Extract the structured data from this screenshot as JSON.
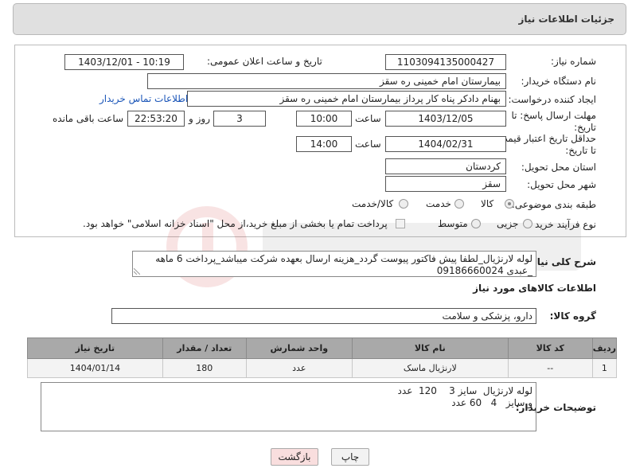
{
  "header": {
    "title": "جزئیات اطلاعات نیاز"
  },
  "form": {
    "need_number_label": "شماره نیاز:",
    "need_number": "1103094135000427",
    "announce_label": "تاریخ و ساعت اعلان عمومی:",
    "announce_value": "1403/12/01 - 10:19",
    "buyer_org_label": "نام دستگاه خریدار:",
    "buyer_org": "بیمارستان امام خمینی  ره  سقز",
    "creator_label": "ایجاد کننده درخواست:",
    "creator": "بهنام دادکر پناه کار پرداز بیمارستان امام خمینی  ره  سقز",
    "contact_link": "اطلاعات تماس خریدار",
    "deadline_label": "مهلت ارسال پاسخ: تا تاریخ:",
    "deadline_date": "1403/12/05",
    "time_label": "ساعت",
    "deadline_time": "10:00",
    "days_value": "3",
    "days_label": "روز و",
    "remaining_time": "22:53:20",
    "remaining_label": "ساعت باقی مانده",
    "validity_label": "حداقل تاریخ اعتبار قیمت: تا تاریخ:",
    "validity_date": "1404/02/31",
    "validity_time": "14:00",
    "province_label": "استان محل تحویل:",
    "province": "کردستان",
    "city_label": "شهر محل تحویل:",
    "city": "سقز",
    "category_label": "طبقه بندی موضوعی:",
    "category_options": [
      "کالا",
      "خدمت",
      "کالا/خدمت"
    ],
    "process_label": "نوع فرآیند خرید :",
    "process_options": [
      "جزیی",
      "متوسط"
    ],
    "payment_note": "پرداخت تمام یا بخشی از مبلغ خرید،از محل \"اسناد خزانه اسلامی\" خواهد بود."
  },
  "description": {
    "label": "شرح کلی نیاز:",
    "text": "لوله لارنژیال_لطفا پیش فاکتور پیوست گردد_هزینه ارسال بعهده شرکت میباشد_پرداخت 6 ماهه _عبدی 09186660024"
  },
  "goods": {
    "section_title": "اطلاعات کالاهای مورد نیاز",
    "group_label": "گروه کالا:",
    "group_value": "دارو، پزشکی و سلامت",
    "columns": [
      "ردیف",
      "کد کالا",
      "نام کالا",
      "واحد شمارش",
      "تعداد / مقدار",
      "تاریخ نیاز"
    ],
    "rows": [
      [
        "1",
        "--",
        "لارنژیال ماسک",
        "عدد",
        "180",
        "1404/01/14"
      ]
    ]
  },
  "buyer_notes": {
    "label": "توضیحات خریدار:",
    "text": "لوله لارنژیال  سایز 3    120  عدد\nو سایز   4   60 عدد"
  },
  "buttons": {
    "print": "چاپ",
    "back": "بازگشت"
  },
  "colors": {
    "header_bg": "#e0e0e0",
    "table_header_bg": "#a9a9a9",
    "link": "#1a55b8",
    "back_button_bg": "#f9dede"
  }
}
